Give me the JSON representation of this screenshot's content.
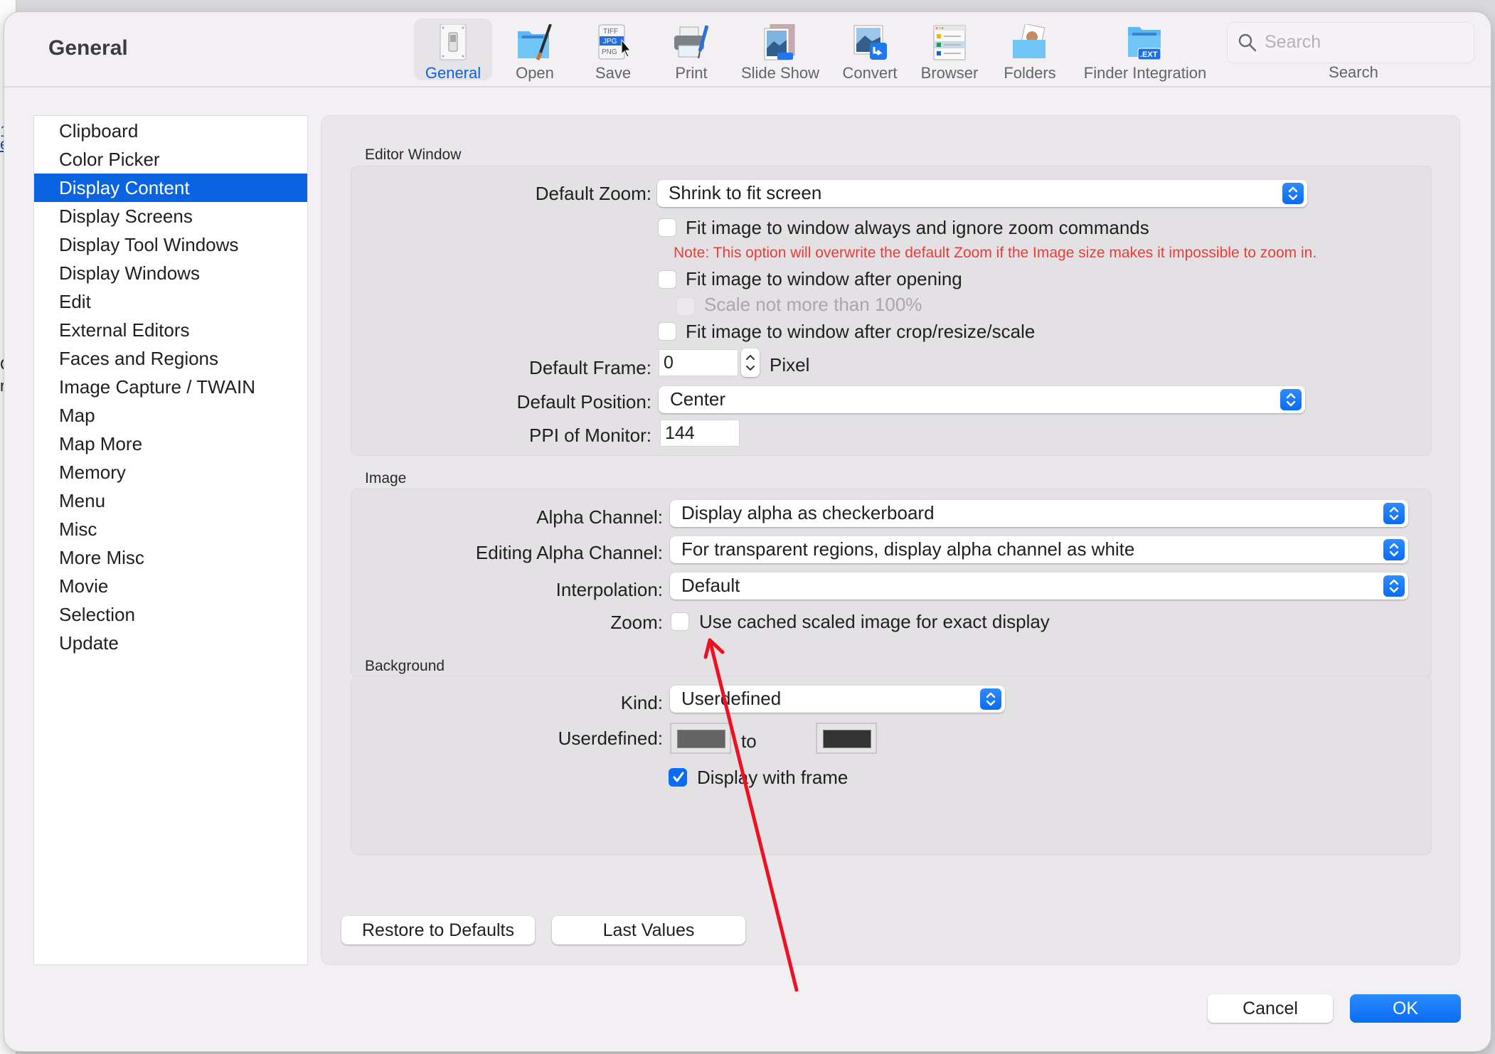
{
  "background_app": {
    "fragments": [
      "1",
      "e",
      "C",
      "r"
    ]
  },
  "window": {
    "title": "General"
  },
  "toolbar": {
    "items": [
      {
        "label": "General",
        "icon": "switch-icon",
        "active": true
      },
      {
        "label": "Open",
        "icon": "folder-brush-icon",
        "active": false
      },
      {
        "label": "Save",
        "icon": "file-formats-icon",
        "active": false
      },
      {
        "label": "Print",
        "icon": "printer-icon",
        "active": false
      },
      {
        "label": "Slide Show",
        "icon": "slideshow-icon",
        "active": false
      },
      {
        "label": "Convert",
        "icon": "convert-icon",
        "active": false
      },
      {
        "label": "Browser",
        "icon": "browser-icon",
        "active": false
      },
      {
        "label": "Folders",
        "icon": "folders-icon",
        "active": false
      },
      {
        "label": "Finder Integration",
        "icon": "finder-integration-icon",
        "active": false
      }
    ],
    "search": {
      "placeholder": "Search",
      "label": "Search"
    }
  },
  "sidebar": {
    "items": [
      {
        "label": "Clipboard",
        "selected": false
      },
      {
        "label": "Color Picker",
        "selected": false
      },
      {
        "label": "Display Content",
        "selected": true
      },
      {
        "label": "Display Screens",
        "selected": false
      },
      {
        "label": "Display Tool Windows",
        "selected": false
      },
      {
        "label": "Display Windows",
        "selected": false
      },
      {
        "label": "Edit",
        "selected": false
      },
      {
        "label": "External Editors",
        "selected": false
      },
      {
        "label": "Faces and Regions",
        "selected": false
      },
      {
        "label": "Image Capture / TWAIN",
        "selected": false
      },
      {
        "label": "Map",
        "selected": false
      },
      {
        "label": "Map More",
        "selected": false
      },
      {
        "label": "Memory",
        "selected": false
      },
      {
        "label": "Menu",
        "selected": false
      },
      {
        "label": "Misc",
        "selected": false
      },
      {
        "label": "More Misc",
        "selected": false
      },
      {
        "label": "Movie",
        "selected": false
      },
      {
        "label": "Selection",
        "selected": false
      },
      {
        "label": "Update",
        "selected": false
      }
    ]
  },
  "editor_window": {
    "section_label": "Editor Window",
    "default_zoom": {
      "label": "Default Zoom:",
      "value": "Shrink to fit screen"
    },
    "fit_always": {
      "label": "Fit image to window always and ignore zoom commands",
      "checked": false
    },
    "note": "Note: This option will overwrite the default Zoom if the Image size makes it impossible to zoom in.",
    "fit_after_opening": {
      "label": "Fit image to window after opening",
      "checked": false
    },
    "scale_not_more": {
      "label": "Scale not more than 100%",
      "checked": false,
      "enabled": false
    },
    "fit_after_crop": {
      "label": "Fit image to window after crop/resize/scale",
      "checked": false
    },
    "default_frame": {
      "label": "Default Frame:",
      "value": "0",
      "unit": "Pixel"
    },
    "default_position": {
      "label": "Default Position:",
      "value": "Center"
    },
    "ppi": {
      "label": "PPI of Monitor:",
      "value": "144"
    }
  },
  "image": {
    "section_label": "Image",
    "alpha_channel": {
      "label": "Alpha Channel:",
      "value": "Display alpha as checkerboard"
    },
    "editing_alpha": {
      "label": "Editing Alpha Channel:",
      "value": "For transparent regions, display alpha channel as white"
    },
    "interpolation": {
      "label": "Interpolation:",
      "value": "Default"
    },
    "zoom": {
      "label": "Zoom:",
      "option": "Use cached scaled image for exact display",
      "checked": false
    }
  },
  "background": {
    "section_label": "Background",
    "kind": {
      "label": "Kind:",
      "value": "Userdefined"
    },
    "userdefined": {
      "label": "Userdefined:",
      "to_label": "to",
      "color_from": "#646464",
      "color_to": "#333333"
    },
    "display_with_frame": {
      "label": "Display with frame",
      "checked": true
    }
  },
  "buttons": {
    "restore_defaults": "Restore to Defaults",
    "last_values": "Last Values",
    "cancel": "Cancel",
    "ok": "OK"
  },
  "colors": {
    "accent": "#0a63e0",
    "note_red": "#ef3b36",
    "annotation_arrow": "#ee1122"
  }
}
